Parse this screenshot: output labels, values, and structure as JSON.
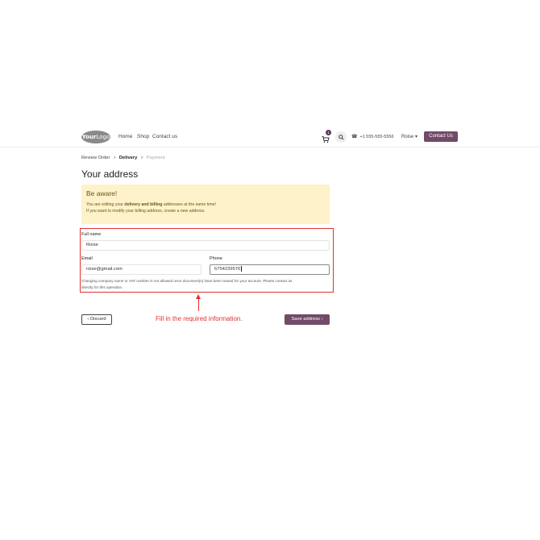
{
  "nav": {
    "logo_bold": "Your",
    "logo_rest": "Logo",
    "links": [
      "Home",
      "Shop",
      "Contact us"
    ],
    "cart_count": "1",
    "phone": "+1 555-555-5556",
    "user": "Roise",
    "contact_btn": "Contact Us"
  },
  "breadcrumb": [
    "Review Order",
    ">",
    "Delivery",
    ">",
    "Payment"
  ],
  "page_title": "Your address",
  "alert": {
    "title": "Be aware!",
    "line1_pre": "You are editing your ",
    "line1_bold": "delivery and billing",
    "line1_post": " addresses at the same time!",
    "line2": "If you want to modify your billing address, create a new address."
  },
  "form": {
    "fullname_label": "Full name",
    "fullname_value": "Roise",
    "email_label": "Email",
    "email_value": "roise@gmail.com",
    "phone_label": "Phone",
    "phone_value": "6754239576",
    "note_line1": "Changing company name or VAT number is not allowed once document(s) have been issued for your account. Please contact us",
    "note_line2": "directly for this operation."
  },
  "annotation": "Fill in the required information.",
  "buttons": {
    "discard": "Discard",
    "save": "Save address"
  },
  "colors": {
    "brand": "#714b67",
    "annotation": "#e0312f",
    "alert_bg": "#fdf2c9"
  }
}
